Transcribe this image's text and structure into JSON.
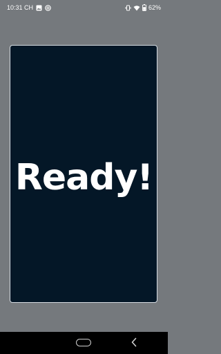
{
  "status_bar": {
    "time": "10:31 CH",
    "battery_percent": "62%",
    "left_icons": [
      "gallery-icon",
      "at-sign-icon"
    ],
    "right_icons": [
      "vibrate-icon",
      "wifi-icon",
      "battery-icon"
    ]
  },
  "main": {
    "message": "Ready!",
    "card_color": "#041727",
    "background_color": "#75797d"
  },
  "nav_bar": {
    "items": [
      "home-button",
      "back-button"
    ]
  }
}
